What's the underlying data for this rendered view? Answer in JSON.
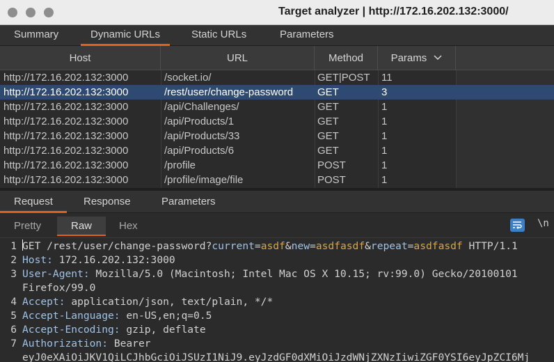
{
  "window": {
    "title": "Target analyzer | http://172.16.202.132:3000/"
  },
  "top_tabs": [
    "Summary",
    "Dynamic URLs",
    "Static URLs",
    "Parameters"
  ],
  "table": {
    "columns": [
      "Host",
      "URL",
      "Method",
      "Params"
    ],
    "sort_indicator": "chevron-down",
    "rows": [
      {
        "host": "http://172.16.202.132:3000",
        "url": "/socket.io/",
        "method": "GET|POST",
        "params": "11"
      },
      {
        "host": "http://172.16.202.132:3000",
        "url": "/rest/user/change-password",
        "method": "GET",
        "params": "3"
      },
      {
        "host": "http://172.16.202.132:3000",
        "url": "/api/Challenges/",
        "method": "GET",
        "params": "1"
      },
      {
        "host": "http://172.16.202.132:3000",
        "url": "/api/Products/1",
        "method": "GET",
        "params": "1"
      },
      {
        "host": "http://172.16.202.132:3000",
        "url": "/api/Products/33",
        "method": "GET",
        "params": "1"
      },
      {
        "host": "http://172.16.202.132:3000",
        "url": "/api/Products/6",
        "method": "GET",
        "params": "1"
      },
      {
        "host": "http://172.16.202.132:3000",
        "url": "/profile",
        "method": "POST",
        "params": "1"
      },
      {
        "host": "http://172.16.202.132:3000",
        "url": "/profile/image/file",
        "method": "POST",
        "params": "1"
      }
    ]
  },
  "request_tabs": [
    "Request",
    "Response",
    "Parameters"
  ],
  "view_tabs": [
    "Pretty",
    "Raw",
    "Hex"
  ],
  "newline_toggle": "\\n",
  "editor": {
    "request_line": {
      "method": "GET",
      "path": "/rest/user/change-password?",
      "params": [
        {
          "key": "current",
          "value": "asdf"
        },
        {
          "key": "new",
          "value": "asdfasdf"
        },
        {
          "key": "repeat",
          "value": "asdfasdf"
        }
      ],
      "protocol": "HTTP/1.1"
    },
    "line_numbers": [
      "1",
      "2",
      "3",
      "4",
      "5",
      "6",
      "7"
    ],
    "headers": [
      {
        "name": "Host:",
        "value": "172.16.202.132:3000"
      },
      {
        "name": "User-Agent:",
        "value": "Mozilla/5.0 (Macintosh; Intel Mac OS X 10.15; rv:99.0) Gecko/20100101",
        "cont": "Firefox/99.0"
      },
      {
        "name": "Accept:",
        "value": "application/json, text/plain, */*"
      },
      {
        "name": "Accept-Language:",
        "value": "en-US,en;q=0.5"
      },
      {
        "name": "Accept-Encoding:",
        "value": "gzip, deflate"
      },
      {
        "name": "Authorization:",
        "value": "Bearer",
        "cont": "eyJ0eXAiOiJKV1QiLCJhbGciOiJSUzI1NiJ9.eyJzdGF0dXMiOiJzdWNjZXNzIiwiZGF0YSI6eyJpZCI6Mj"
      }
    ]
  },
  "colors": {
    "accent": "#e2611b",
    "selection": "#2f4a72",
    "header_key": "#9fc3e8",
    "param_value": "#d4a655",
    "wrap_button": "#3c7fc6"
  }
}
